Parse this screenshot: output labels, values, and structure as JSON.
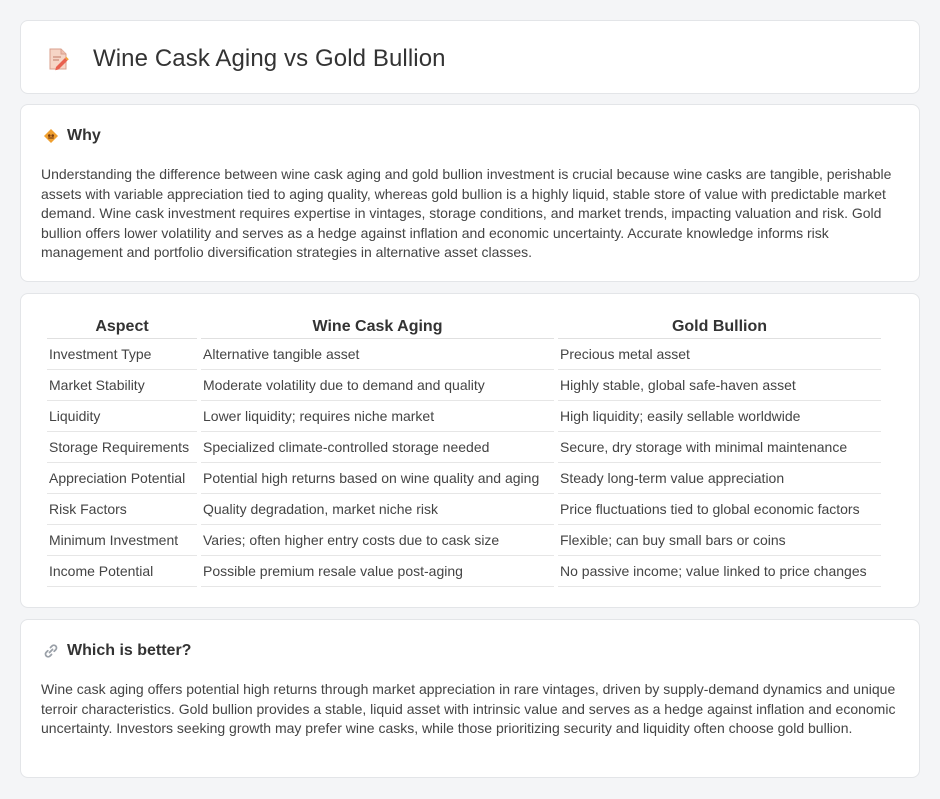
{
  "page": {
    "title": "Wine Cask Aging vs Gold Bullion",
    "title_icon": "document-pencil-icon"
  },
  "why": {
    "heading": "Why",
    "icon": "lightbulb-diamond-icon",
    "text": "Understanding the difference between wine cask aging and gold bullion investment is crucial because wine casks are tangible, perishable assets with variable appreciation tied to aging quality, whereas gold bullion is a highly liquid, stable store of value with predictable market demand. Wine cask investment requires expertise in vintages, storage conditions, and market trends, impacting valuation and risk. Gold bullion offers lower volatility and serves as a hedge against inflation and economic uncertainty. Accurate knowledge informs risk management and portfolio diversification strategies in alternative asset classes."
  },
  "comparison": {
    "headers": [
      "Aspect",
      "Wine Cask Aging",
      "Gold Bullion"
    ],
    "rows": [
      [
        "Investment Type",
        "Alternative tangible asset",
        "Precious metal asset"
      ],
      [
        "Market Stability",
        "Moderate volatility due to demand and quality",
        "Highly stable, global safe-haven asset"
      ],
      [
        "Liquidity",
        "Lower liquidity; requires niche market",
        "High liquidity; easily sellable worldwide"
      ],
      [
        "Storage Requirements",
        "Specialized climate-controlled storage needed",
        "Secure, dry storage with minimal maintenance"
      ],
      [
        "Appreciation Potential",
        "Potential high returns based on wine quality and aging",
        "Steady long-term value appreciation"
      ],
      [
        "Risk Factors",
        "Quality degradation, market niche risk",
        "Price fluctuations tied to global economic factors"
      ],
      [
        "Minimum Investment",
        "Varies; often higher entry costs due to cask size",
        "Flexible; can buy small bars or coins"
      ],
      [
        "Income Potential",
        "Possible premium resale value post-aging",
        "No passive income; value linked to price changes"
      ]
    ]
  },
  "better": {
    "heading": "Which is better?",
    "icon": "link-icon",
    "text": "Wine cask aging offers potential high returns through market appreciation in rare vintages, driven by supply-demand dynamics and unique terroir characteristics. Gold bullion provides a stable, liquid asset with intrinsic value and serves as a hedge against inflation and economic uncertainty. Investors seeking growth may prefer wine casks, while those prioritizing security and liquidity often choose gold bullion."
  },
  "colors": {
    "background": "#f4f5f7",
    "card": "#ffffff",
    "border": "#e3e5e8",
    "icon_orange": "#f0a030",
    "icon_red": "#e0574f"
  }
}
